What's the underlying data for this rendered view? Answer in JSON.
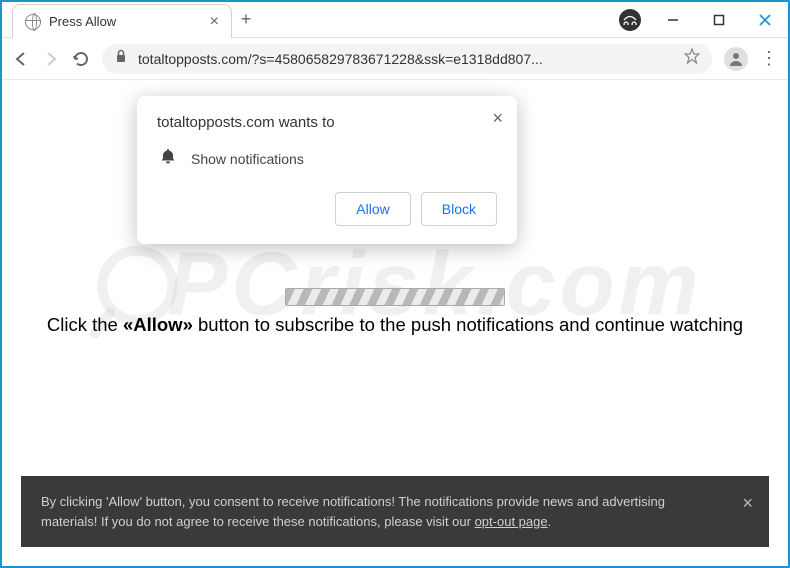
{
  "window": {
    "tab_title": "Press Allow"
  },
  "toolbar": {
    "url": "totaltopposts.com/?s=458065829783671228&ssk=e1318dd807..."
  },
  "dialog": {
    "title": "totaltopposts.com wants to",
    "permission_label": "Show notifications",
    "allow_label": "Allow",
    "block_label": "Block"
  },
  "page": {
    "instruction_prefix": "Click the ",
    "instruction_bold": "«Allow»",
    "instruction_suffix": " button to subscribe to the push notifications and continue watching",
    "watermark": "PCrisk.com"
  },
  "cookie": {
    "text_part1": "By clicking 'Allow' button, you consent to receive notifications! The notifications provide news and advertising materials! If you do not agree to receive these notifications, please visit our ",
    "link_text": "opt-out page",
    "text_part2": "."
  }
}
